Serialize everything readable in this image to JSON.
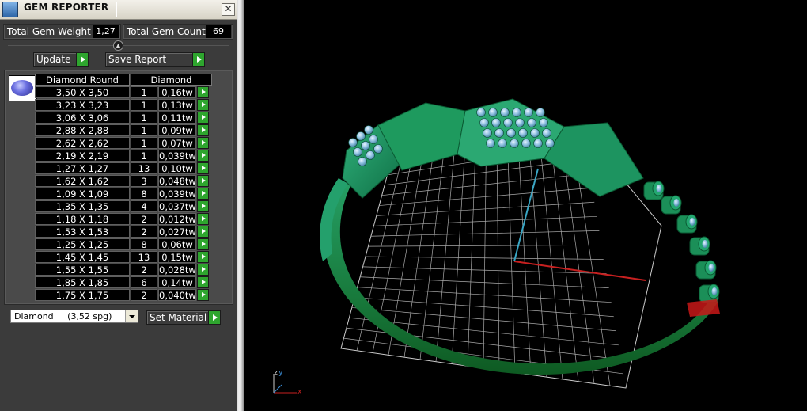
{
  "window": {
    "title": "GEM REPORTER",
    "close_glyph": "✕"
  },
  "stats": {
    "weight_label": "Total Gem Weight",
    "weight_value": "1,27",
    "count_label": "Total Gem Count",
    "count_value": "69"
  },
  "toolbar": {
    "update_label": "Update",
    "save_label": "Save Report"
  },
  "table": {
    "headers": [
      "Diamond Round",
      "Diamond"
    ],
    "rows": [
      {
        "size": "3,50 X 3,50",
        "count": "1",
        "weight": "0,16tw"
      },
      {
        "size": "3,23 X 3,23",
        "count": "1",
        "weight": "0,13tw"
      },
      {
        "size": "3,06 X 3,06",
        "count": "1",
        "weight": "0,11tw"
      },
      {
        "size": "2,88 X 2,88",
        "count": "1",
        "weight": "0,09tw"
      },
      {
        "size": "2,62 X 2,62",
        "count": "1",
        "weight": "0,07tw"
      },
      {
        "size": "2,19 X 2,19",
        "count": "1",
        "weight": "0,039tw"
      },
      {
        "size": "1,27 X 1,27",
        "count": "13",
        "weight": "0,10tw"
      },
      {
        "size": "1,62 X 1,62",
        "count": "3",
        "weight": "0,048tw"
      },
      {
        "size": "1,09 X 1,09",
        "count": "8",
        "weight": "0,039tw"
      },
      {
        "size": "1,35 X 1,35",
        "count": "4",
        "weight": "0,037tw"
      },
      {
        "size": "1,18 X 1,18",
        "count": "2",
        "weight": "0,012tw"
      },
      {
        "size": "1,53 X 1,53",
        "count": "2",
        "weight": "0,027tw"
      },
      {
        "size": "1,25 X 1,25",
        "count": "8",
        "weight": "0,06tw"
      },
      {
        "size": "1,45 X 1,45",
        "count": "13",
        "weight": "0,15tw"
      },
      {
        "size": "1,55 X 1,55",
        "count": "2",
        "weight": "0,028tw"
      },
      {
        "size": "1,85 X 1,85",
        "count": "6",
        "weight": "0,14tw"
      },
      {
        "size": "1,75 X 1,75",
        "count": "2",
        "weight": "0,040tw"
      }
    ]
  },
  "material": {
    "selected": "Diamond     (3,52 spg)",
    "set_label": "Set Material"
  },
  "viewport": {
    "axis_z": "z",
    "axis_y": "y",
    "axis_x": "x"
  },
  "colors": {
    "accent_green": "#2ea52e",
    "ring_green": "#1c8a4a",
    "grid": "#bbbbbb"
  }
}
